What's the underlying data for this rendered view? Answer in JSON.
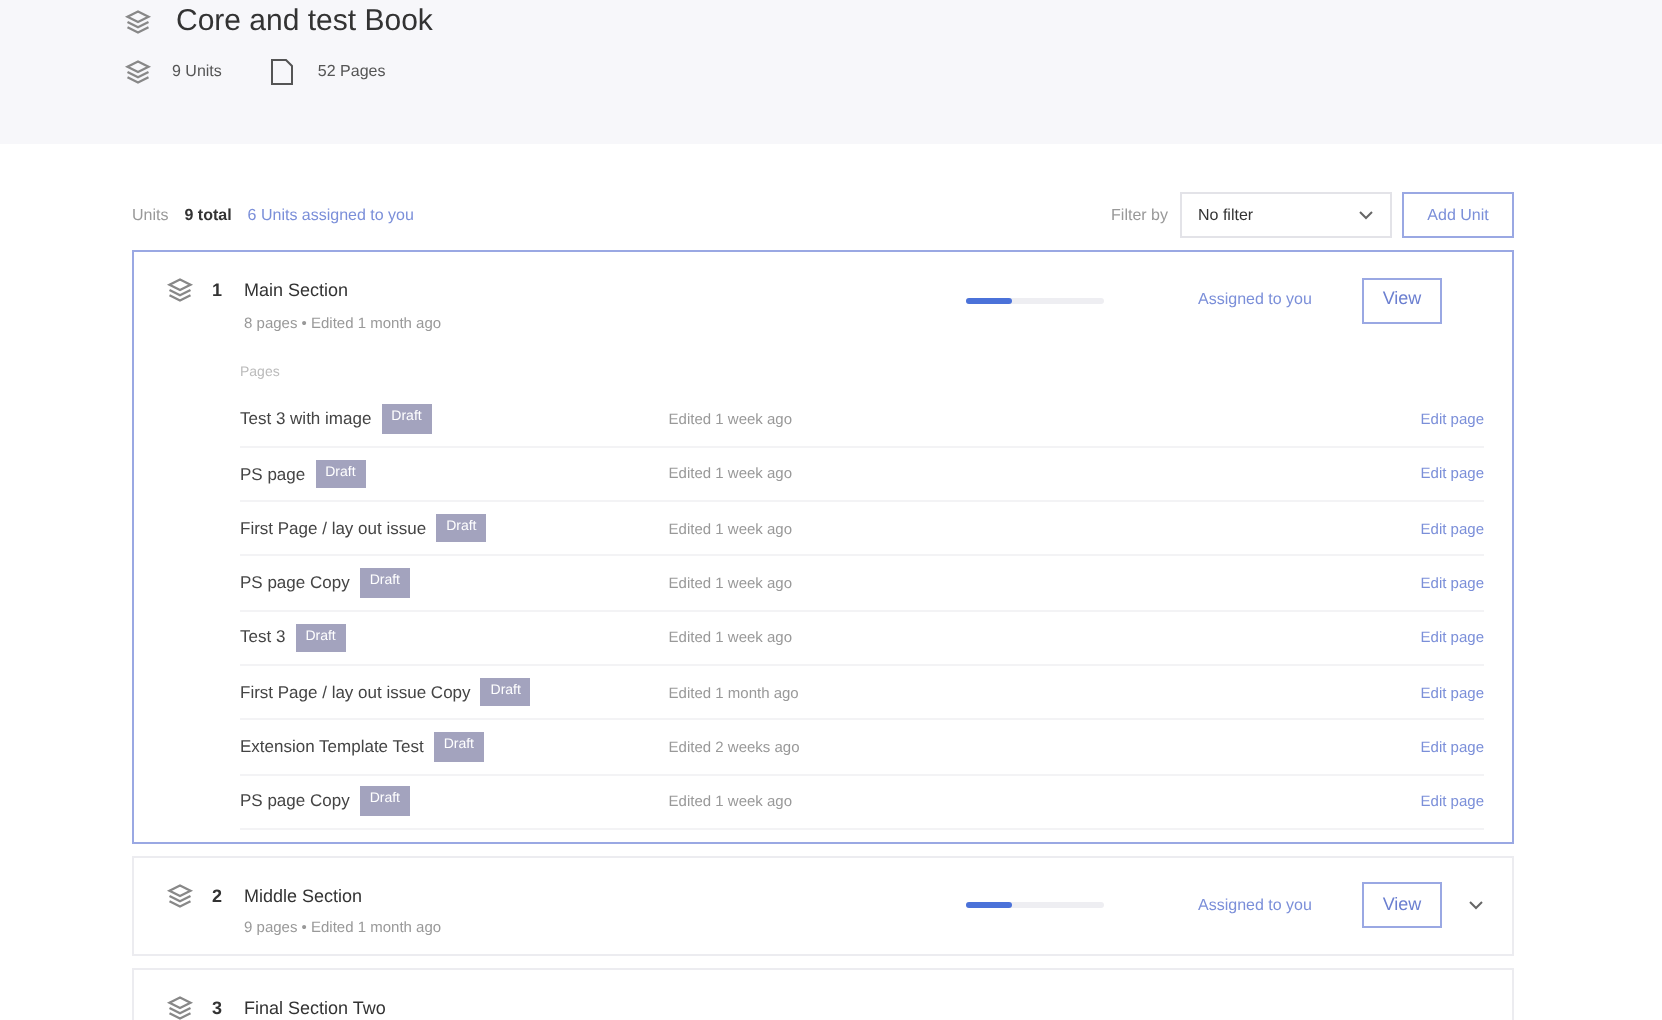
{
  "book": {
    "title": "Core and test Book",
    "units_count": "9 Units",
    "pages_count": "52 Pages"
  },
  "toolbar": {
    "label": "Units",
    "total": "9 total",
    "assigned": "6 Units assigned to you",
    "filter_label": "Filter by",
    "filter_value": "No filter",
    "add_button": "Add Unit"
  },
  "units": [
    {
      "number": "1",
      "title": "Main Section",
      "meta": "8 pages • Edited 1 month ago",
      "level": 0.33,
      "assigned": "Assigned to you",
      "button": "View",
      "expanded": true,
      "pages_label": "Pages",
      "pages": [
        {
          "title": "Test 3 with image",
          "badge": "Draft",
          "edited": "Edited 1 week ago",
          "action": "Edit page"
        },
        {
          "title": "PS page",
          "badge": "Draft",
          "edited": "Edited 1 week ago",
          "action": "Edit page"
        },
        {
          "title": "First Page / lay out issue",
          "badge": "Draft",
          "edited": "Edited 1 week ago",
          "action": "Edit page"
        },
        {
          "title": "PS page Copy",
          "badge": "Draft",
          "edited": "Edited 1 week ago",
          "action": "Edit page"
        },
        {
          "title": "Test 3",
          "badge": "Draft",
          "edited": "Edited 1 week ago",
          "action": "Edit page"
        },
        {
          "title": "First Page / lay out issue Copy",
          "badge": "Draft",
          "edited": "Edited 1 month ago",
          "action": "Edit page"
        },
        {
          "title": "Extension Template Test",
          "badge": "Draft",
          "edited": "Edited 2 weeks ago",
          "action": "Edit page"
        },
        {
          "title": "PS page Copy",
          "badge": "Draft",
          "edited": "Edited 1 week ago",
          "action": "Edit page"
        }
      ]
    },
    {
      "number": "2",
      "title": "Middle Section",
      "meta": "9 pages • Edited 1 month ago",
      "level": 0.33,
      "assigned": "Assigned to you",
      "button": "View",
      "expanded": false
    },
    {
      "number": "3",
      "title": "Final Section Two",
      "expanded": false
    }
  ]
}
